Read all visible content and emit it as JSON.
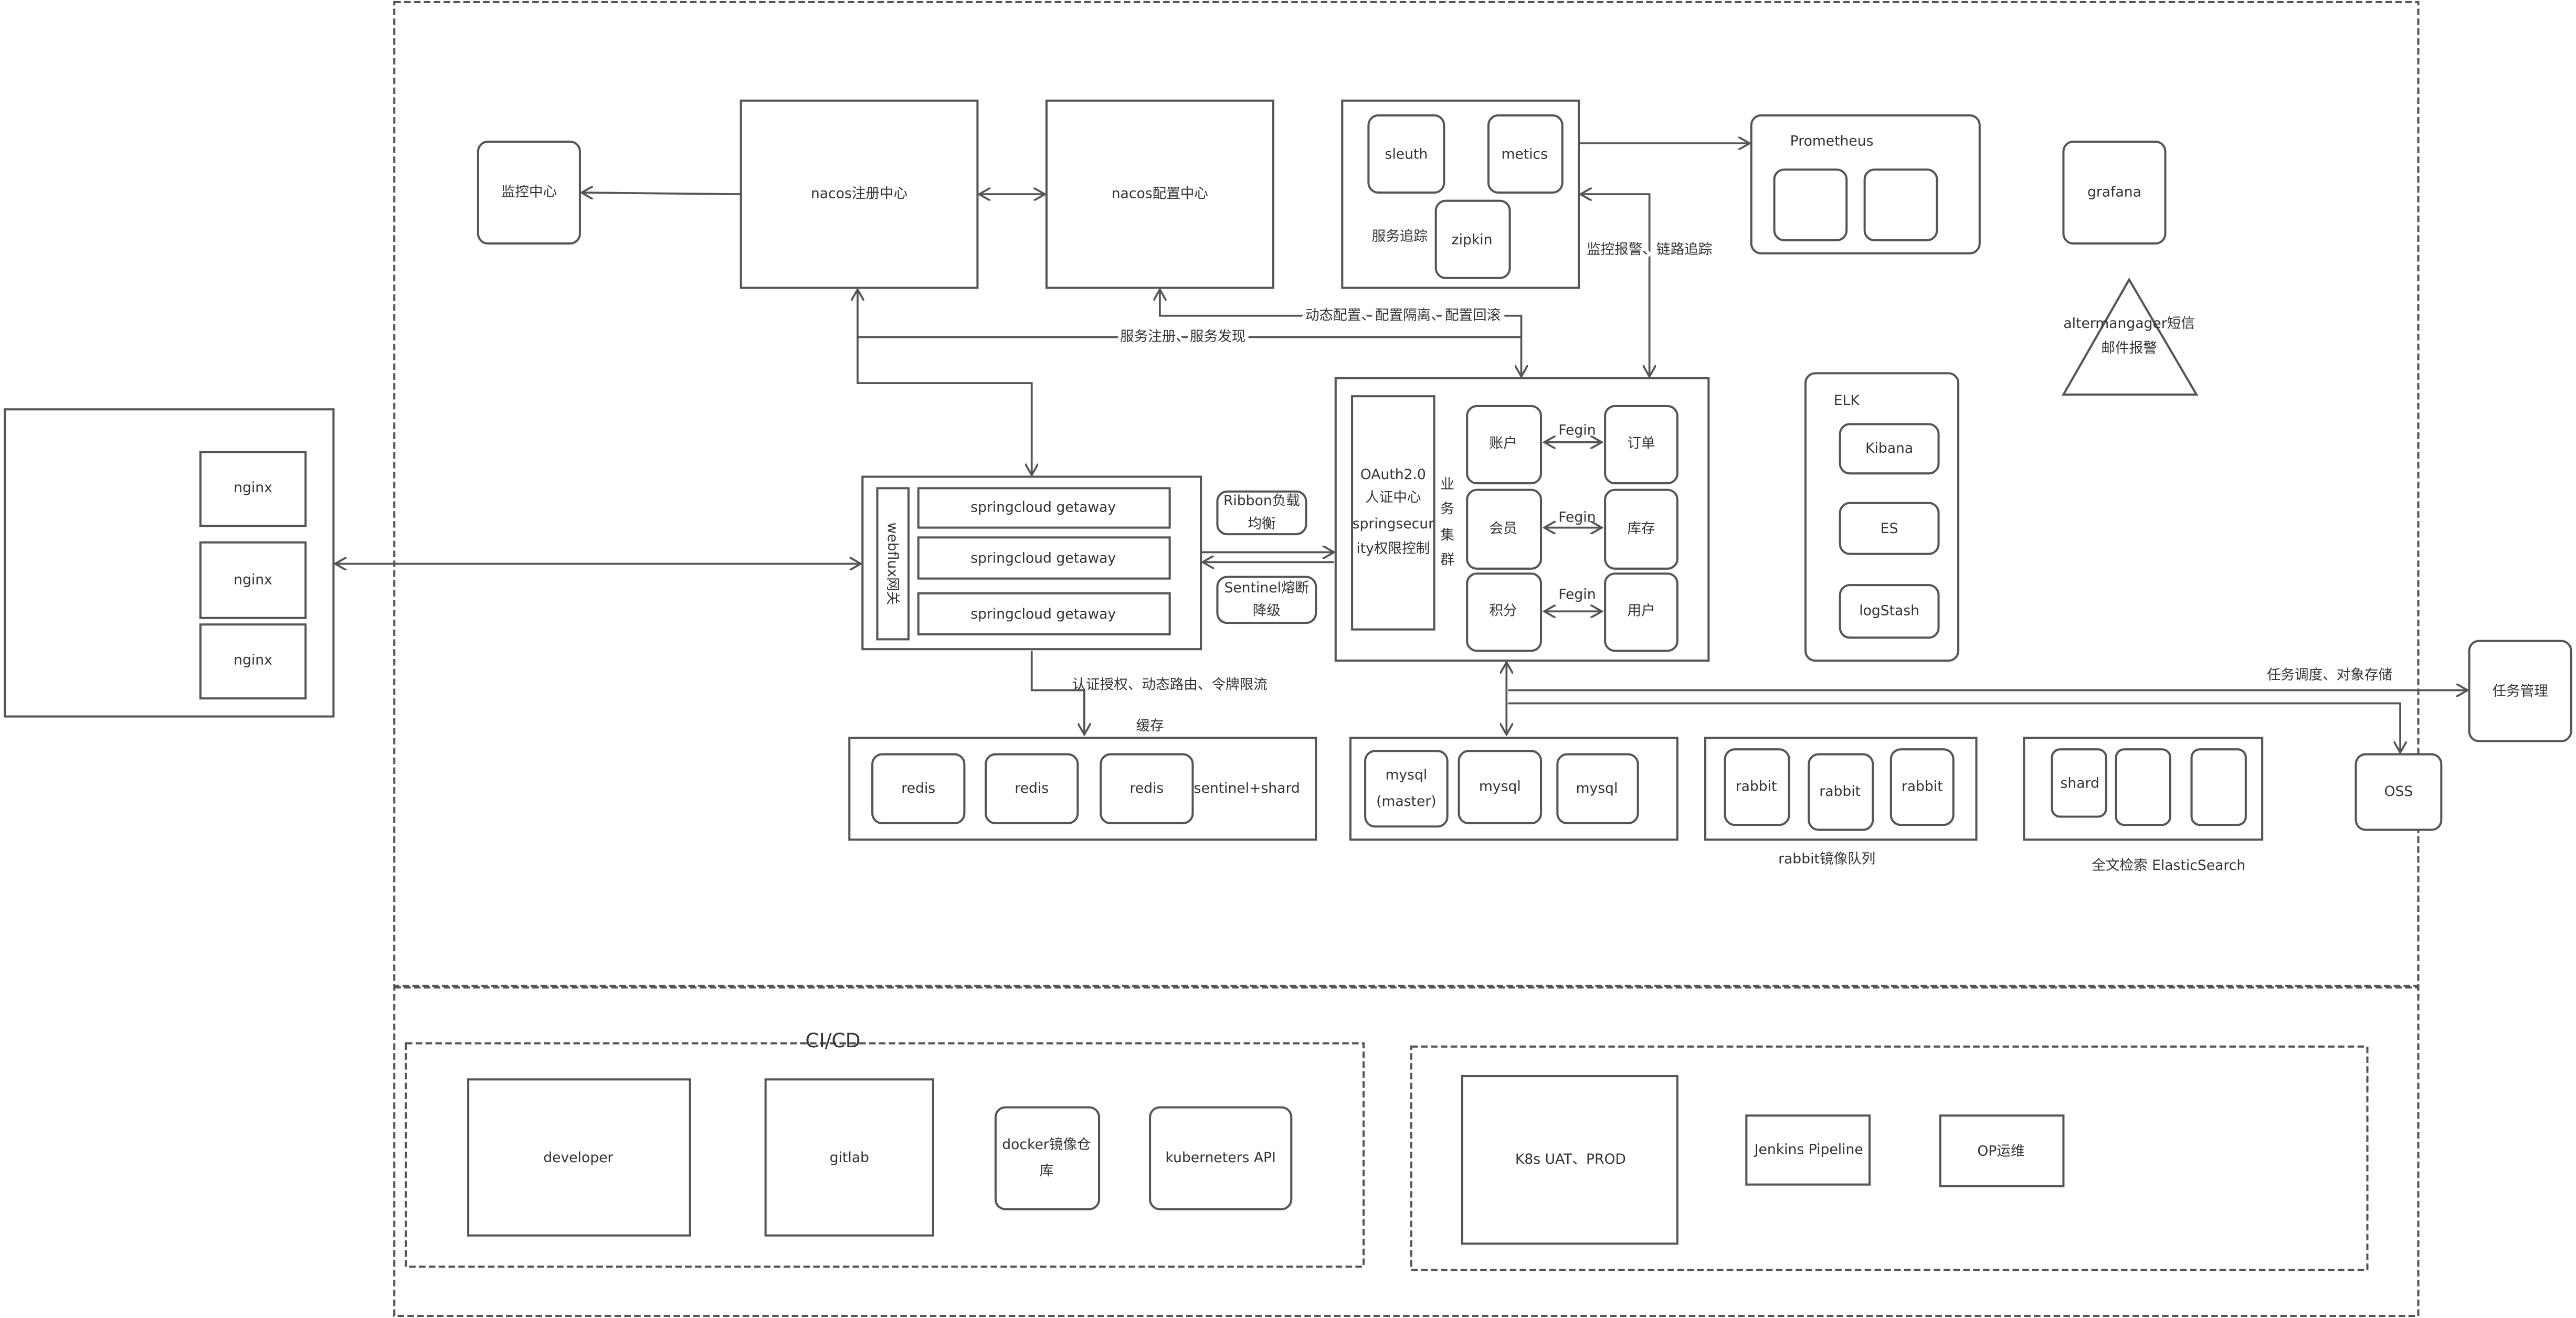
{
  "nginx": {
    "items": [
      "nginx",
      "nginx",
      "nginx"
    ]
  },
  "monitor": "监控中心",
  "nacos_registry": "nacos注册中心",
  "nacos_config": "nacos配置中心",
  "tracing": {
    "sleuth": "sleuth",
    "metics": "metics",
    "zipkin": "zipkin",
    "label": "服务追踪"
  },
  "prometheus": "Prometheus",
  "grafana": "grafana",
  "alert": {
    "line1": "altermangager短信",
    "line2": "邮件报警"
  },
  "edges": {
    "monitor_alert": "监控报警、链路追踪",
    "dynamic_config": "动态配置、配置隔离、配置回滚",
    "registry": "服务注册、服务发现",
    "auth_route": "认证授权、动态路由、令牌限流",
    "cache": "缓存",
    "task_oss": "任务调度、对象存储"
  },
  "gateway": {
    "webflux": "webflux网关",
    "items": [
      "springcloud getaway",
      "springcloud getaway",
      "springcloud getaway"
    ],
    "ribbon": [
      "Ribbon负载",
      "均衡"
    ],
    "sentinel": [
      "Sentinel熔断",
      "降级"
    ]
  },
  "business": {
    "oauth": [
      "OAuth2.0",
      "人证中心",
      "springsecur",
      "ity权限控制"
    ],
    "cluster": [
      "业",
      "务",
      "集",
      "群"
    ],
    "services": [
      "账户",
      "订单",
      "会员",
      "库存",
      "积分",
      "用户"
    ],
    "fegin": "Fegin"
  },
  "elk": {
    "title": "ELK",
    "items": [
      "Kibana",
      "ES",
      "logStash"
    ]
  },
  "redis": {
    "items": [
      "redis",
      "redis",
      "redis"
    ],
    "label": "sentinel+shard"
  },
  "mysql": {
    "master": [
      "mysql",
      "(master)"
    ],
    "items": [
      "mysql",
      "mysql"
    ]
  },
  "rabbit": {
    "items": [
      "rabbit",
      "rabbit",
      "rabbit"
    ],
    "label": "rabbit镜像队列"
  },
  "es": {
    "shard": "shard",
    "label": "全文检索 ElasticSearch"
  },
  "task": "任务管理",
  "oss": "OSS",
  "cicd": {
    "title": "CI/CD",
    "developer": "developer",
    "gitlab": "gitlab",
    "docker": [
      "docker镜像仓",
      "库"
    ],
    "k8s_api": "kuberneters API"
  },
  "ops": {
    "k8s": "K8s UAT、PROD",
    "jenkins": "Jenkins Pipeline",
    "op": "OP运维"
  },
  "colors": {
    "stroke": "#555555",
    "text": "#333333"
  }
}
